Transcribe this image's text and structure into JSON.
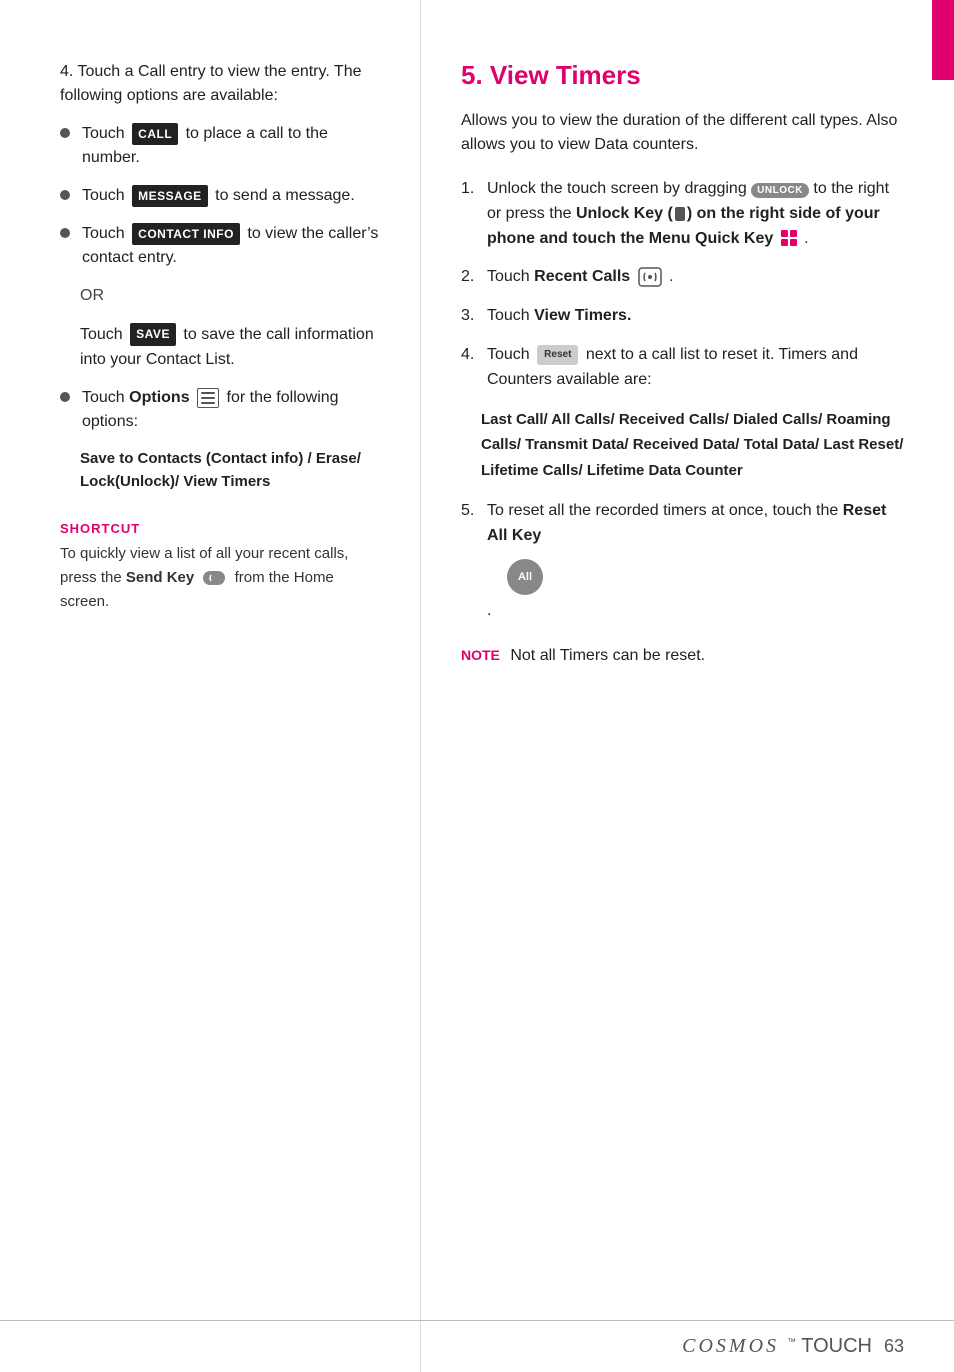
{
  "rightTab": {
    "color": "#e0006e"
  },
  "leftCol": {
    "step4": "4. Touch a Call entry to view the entry. The following options are available:",
    "bullets": [
      {
        "prefix": "Touch",
        "badge": "CALL",
        "suffix": "to place a call to the number."
      },
      {
        "prefix": "Touch",
        "badge": "MESSAGE",
        "suffix": "to send a message."
      },
      {
        "prefix": "Touch",
        "badge": "CONTACT INFO",
        "suffix": "to view the caller’s contact entry."
      }
    ],
    "or": "OR",
    "saveBlock": {
      "prefix": "Touch",
      "badge": "SAVE",
      "suffix": "to save the call information into your Contact List."
    },
    "optionsBullet": {
      "prefix": "Touch",
      "bold": "Options",
      "suffix": "for the following options:"
    },
    "optionsDetail": "Save to Contacts (Contact info) / Erase/ Lock(Unlock)/ View Timers",
    "shortcut": {
      "label": "SHORTCUT",
      "text1": "To quickly view a list of all your recent calls, press the",
      "sendKey": "Send Key",
      "text2": "from the Home screen."
    }
  },
  "rightCol": {
    "sectionNum": "5.",
    "sectionTitle": "View Timers",
    "intro": "Allows you to view the duration of the different call types. Also allows you to view Data counters.",
    "steps": [
      {
        "num": "1.",
        "text1": "Unlock the touch screen by dragging",
        "unlockLabel": "UNLOCK",
        "text2": "to the right or press the",
        "boldText1": "Unlock Key (",
        "keySymbol": "■",
        "boldText2": ") on the right side of your phone and touch the",
        "boldText3": "Menu Quick Key"
      },
      {
        "num": "2.",
        "text1": "Touch",
        "boldText": "Recent Calls"
      },
      {
        "num": "3.",
        "text1": "Touch",
        "boldText": "View Timers."
      },
      {
        "num": "4.",
        "text1": "Touch",
        "resetLabel": "Reset",
        "text2": "next to a call list to reset it. Timers and Counters available are:"
      }
    ],
    "callsList": "Last Call/ All Calls/ Received Calls/ Dialed Calls/ Roaming Calls/ Transmit Data/ Received Data/ Total Data/ Last Reset/ Lifetime Calls/ Lifetime Data Counter",
    "step5": {
      "num": "5.",
      "text1": "To reset all the recorded timers at once, touch the",
      "boldText": "Reset All Key",
      "iconLabel": "All"
    },
    "note": {
      "label": "NOTE",
      "text": "Not all Timers can be reset."
    }
  },
  "footer": {
    "brand": "COSMOS",
    "touch": "TOUCH",
    "pageNum": "63"
  }
}
